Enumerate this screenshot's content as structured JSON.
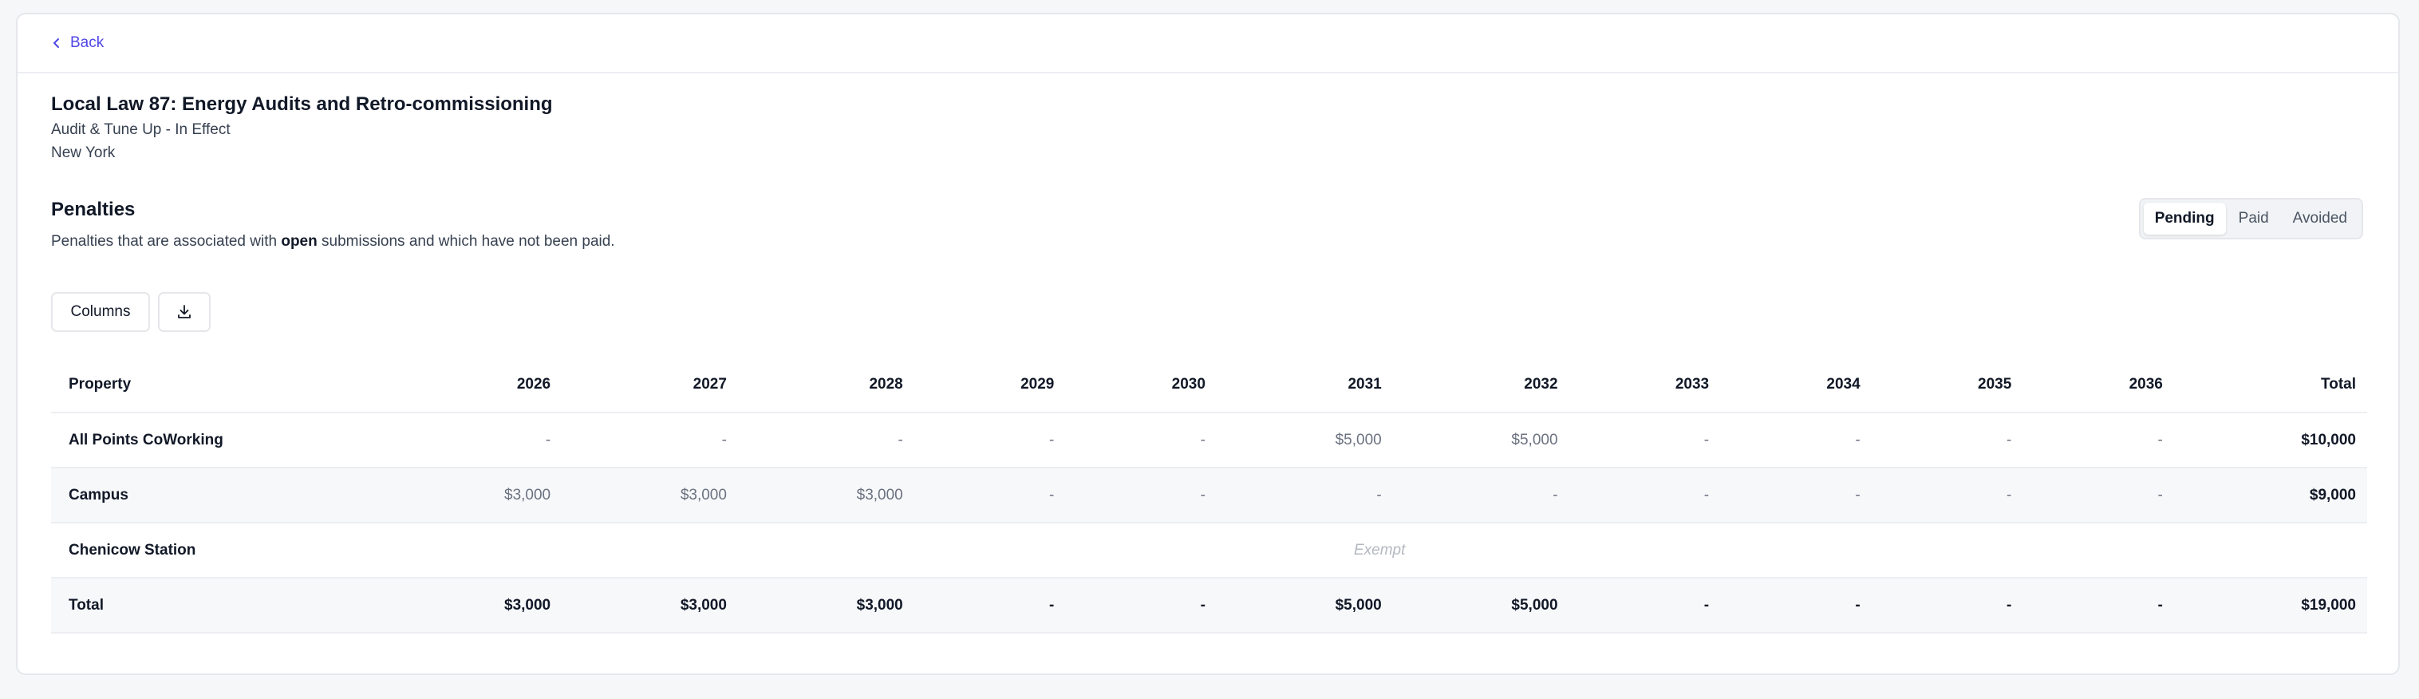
{
  "nav": {
    "back_label": "Back"
  },
  "header": {
    "title": "Local Law 87: Energy Audits and Retro-commissioning",
    "status": "Audit & Tune Up - In Effect",
    "location": "New York"
  },
  "penalties": {
    "title": "Penalties",
    "desc_before": "Penalties that are associated with ",
    "desc_bold": "open",
    "desc_after": " submissions and which have not been paid."
  },
  "segments": [
    {
      "label": "Pending",
      "active": true
    },
    {
      "label": "Paid",
      "active": false
    },
    {
      "label": "Avoided",
      "active": false
    }
  ],
  "toolbar": {
    "columns_label": "Columns",
    "download_icon": "download-icon"
  },
  "table": {
    "headers": [
      "Property",
      "2026",
      "2027",
      "2028",
      "2029",
      "2030",
      "2031",
      "2032",
      "2033",
      "2034",
      "2035",
      "2036",
      "Total"
    ],
    "rows": [
      {
        "property": "All Points CoWorking",
        "values": [
          "-",
          "-",
          "-",
          "-",
          "-",
          "$5,000",
          "$5,000",
          "-",
          "-",
          "-",
          "-"
        ],
        "total": "$10,000"
      },
      {
        "property": "Campus",
        "values": [
          "$3,000",
          "$3,000",
          "$3,000",
          "-",
          "-",
          "-",
          "-",
          "-",
          "-",
          "-",
          "-"
        ],
        "total": "$9,000"
      },
      {
        "property": "Chenicow Station",
        "exempt": "Exempt"
      }
    ],
    "total_row": {
      "label": "Total",
      "values": [
        "$3,000",
        "$3,000",
        "$3,000",
        "-",
        "-",
        "$5,000",
        "$5,000",
        "-",
        "-",
        "-",
        "-"
      ],
      "total": "$19,000"
    }
  },
  "colors": {
    "accent": "#4f46e5",
    "border": "#e5e7eb",
    "stripe": "#f7f8fa"
  }
}
